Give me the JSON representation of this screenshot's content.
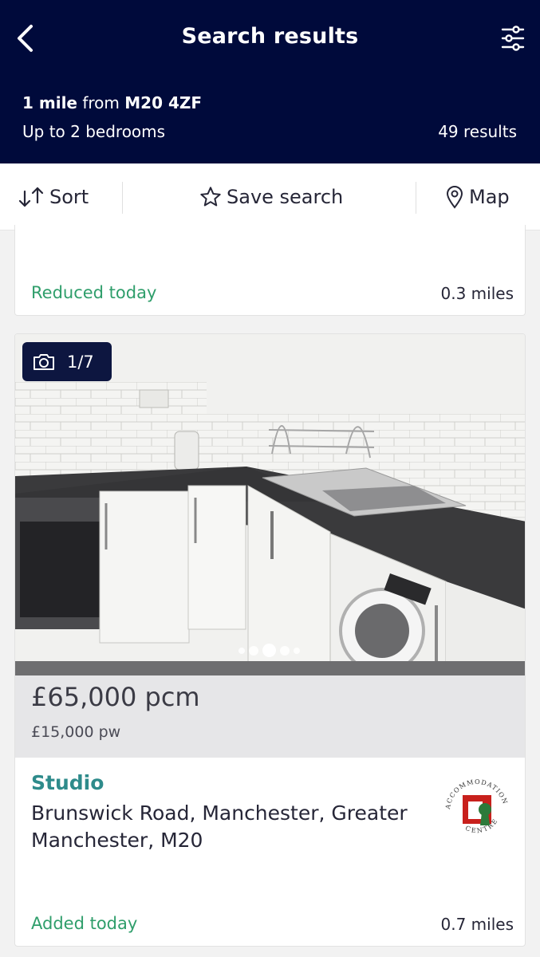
{
  "header": {
    "title": "Search results",
    "radius": "1 mile",
    "from_word": "from",
    "postcode": "M20 4ZF",
    "bedrooms": "Up to 2 bedrooms",
    "results": "49 results"
  },
  "toolbar": {
    "sort_label": "Sort",
    "save_label": "Save search",
    "map_label": "Map"
  },
  "listings": [
    {
      "status": "Reduced today",
      "distance": "0.3 miles"
    },
    {
      "photo_counter": "1/7",
      "photo_total": 7,
      "photo_index": 1,
      "price": "£65,000 pcm",
      "price_pw": "£15,000 pw",
      "type": "Studio",
      "address": "Brunswick Road, Manchester, Greater Manchester, M20",
      "status": "Added today",
      "distance": "0.7 miles",
      "agent_logo_text": "ACCOMMODATION CENTRE"
    }
  ],
  "icons": {
    "back": "chevron-left-icon",
    "filter": "sliders-icon",
    "sort": "sort-arrows-icon",
    "save": "star-outline-icon",
    "map": "map-pin-icon",
    "camera": "camera-icon"
  },
  "colors": {
    "header_bg": "#000a3b",
    "status_green": "#2f9e6b",
    "type_teal": "#2e8b8b",
    "price_band": "#e6e6e8"
  }
}
